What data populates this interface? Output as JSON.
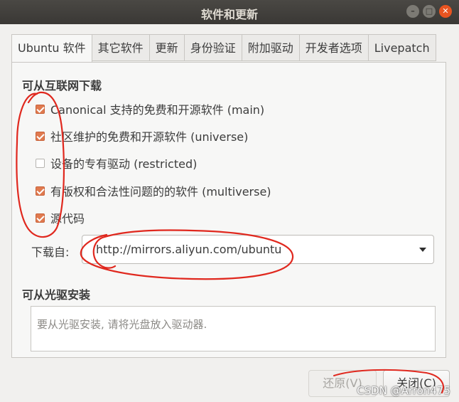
{
  "window": {
    "title": "软件和更新",
    "minimize_glyph": "–",
    "maximize_glyph": "□",
    "close_glyph": "✕"
  },
  "tabs": [
    {
      "label": "Ubuntu 软件",
      "active": true
    },
    {
      "label": "其它软件",
      "active": false
    },
    {
      "label": "更新",
      "active": false
    },
    {
      "label": "身份验证",
      "active": false
    },
    {
      "label": "附加驱动",
      "active": false
    },
    {
      "label": "开发者选项",
      "active": false
    },
    {
      "label": "Livepatch",
      "active": false
    }
  ],
  "internet_section": {
    "heading": "可从互联网下载",
    "options": [
      {
        "label": "Canonical 支持的免费和开源软件 (main)",
        "checked": true
      },
      {
        "label": "社区维护的免费和开源软件 (universe)",
        "checked": true
      },
      {
        "label": "设备的专有驱动 (restricted)",
        "checked": false
      },
      {
        "label": "有版权和合法性问题的的软件 (multiverse)",
        "checked": true
      },
      {
        "label": "源代码",
        "checked": true
      }
    ],
    "download_from_label": "下载自:",
    "download_from_value": "http://mirrors.aliyun.com/ubuntu"
  },
  "cdrom_section": {
    "heading": "可从光驱安装",
    "message": "要从光驱安装, 请将光盘放入驱动器."
  },
  "buttons": {
    "revert": "还原(V)",
    "close": "关闭(C)"
  },
  "watermark": "CSDN @Arron475",
  "colors": {
    "accent": "#e95420",
    "checkbox": "#e07a4f",
    "annotation": "#e0281e"
  }
}
